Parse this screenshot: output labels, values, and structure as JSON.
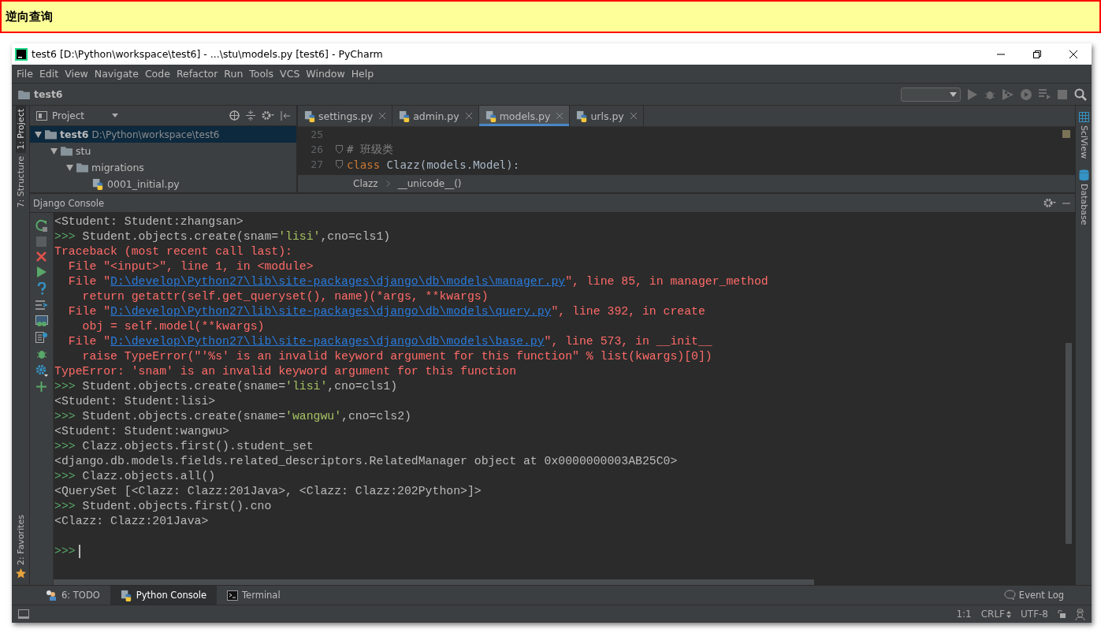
{
  "banner": {
    "title": "逆向查询"
  },
  "window": {
    "title": "test6 [D:\\Python\\workspace\\test6] - ...\\stu\\models.py [test6] - PyCharm"
  },
  "menu": [
    "File",
    "Edit",
    "View",
    "Navigate",
    "Code",
    "Refactor",
    "Run",
    "Tools",
    "VCS",
    "Window",
    "Help"
  ],
  "navigation": {
    "project": "test6"
  },
  "left_strip": [
    {
      "label": "1: Project",
      "selected": true
    },
    {
      "label": "7: Structure",
      "selected": false
    }
  ],
  "favorites": {
    "label": "2: Favorites"
  },
  "project_panel": {
    "title": "Project",
    "tree": [
      {
        "name": "test6",
        "path": "D:\\Python\\workspace\\test6",
        "kind": "folder",
        "selected": true,
        "expanded": true,
        "children": [
          {
            "name": "stu",
            "kind": "folder",
            "selected": false,
            "expanded": true,
            "children": [
              {
                "name": "migrations",
                "kind": "folder",
                "selected": false,
                "expanded": true,
                "children": [
                  {
                    "name": "0001_initial.py",
                    "kind": "python",
                    "selected": false
                  }
                ]
              }
            ]
          }
        ]
      }
    ]
  },
  "editor": {
    "tabs": [
      {
        "label": "settings.py",
        "selected": false
      },
      {
        "label": "admin.py",
        "selected": false
      },
      {
        "label": "models.py",
        "selected": true
      },
      {
        "label": "urls.py",
        "selected": false
      }
    ],
    "lines": [
      {
        "number": "25"
      },
      {
        "number": "26",
        "kind": "comment",
        "text": "# 班级类"
      },
      {
        "number": "27",
        "kind": "code",
        "keyword": "class",
        "text": " Clazz(models.Model):"
      }
    ],
    "breadcrumb": [
      "Clazz",
      "__unicode__()"
    ]
  },
  "right_strip": [
    "SciView",
    "Database"
  ],
  "console": {
    "title": "Django Console",
    "lines": [
      {
        "kind": "output",
        "text": "<Student: Student:zhangsan>"
      },
      {
        "kind": "input",
        "prompt": ">>>",
        "text": "Student.objects.create(snam='lisi',cno=cls1)"
      },
      {
        "kind": "error",
        "text": "Traceback (most recent call last):"
      },
      {
        "kind": "error",
        "text": "  File \"<input>\", line 1, in <module>"
      },
      {
        "kind": "file",
        "prefix": "  File \"",
        "link": "D:\\develop\\Python27\\lib\\site-packages\\django\\db\\models\\manager.py",
        "suffix": "\", line 85, in manager_method"
      },
      {
        "kind": "error",
        "text": "    return getattr(self.get_queryset(), name)(*args, **kwargs)"
      },
      {
        "kind": "file",
        "prefix": "  File \"",
        "link": "D:\\develop\\Python27\\lib\\site-packages\\django\\db\\models\\query.py",
        "suffix": "\", line 392, in create"
      },
      {
        "kind": "error",
        "text": "    obj = self.model(**kwargs)"
      },
      {
        "kind": "file",
        "prefix": "  File \"",
        "link": "D:\\develop\\Python27\\lib\\site-packages\\django\\db\\models\\base.py",
        "suffix": "\", line 573, in __init__"
      },
      {
        "kind": "error",
        "text": "    raise TypeError(\"'%s' is an invalid keyword argument for this function\" % list(kwargs)[0])"
      },
      {
        "kind": "error",
        "text": "TypeError: 'snam' is an invalid keyword argument for this function"
      },
      {
        "kind": "input",
        "prompt": ">>>",
        "text": "Student.objects.create(sname='lisi',cno=cls1)"
      },
      {
        "kind": "output",
        "text": "<Student: Student:lisi>"
      },
      {
        "kind": "input",
        "prompt": ">>>",
        "text": "Student.objects.create(sname='wangwu',cno=cls2)"
      },
      {
        "kind": "output",
        "text": "<Student: Student:wangwu>"
      },
      {
        "kind": "input",
        "prompt": ">>>",
        "text": "Clazz.objects.first().student_set"
      },
      {
        "kind": "output",
        "text": "<django.db.models.fields.related_descriptors.RelatedManager object at 0x0000000003AB25C0>"
      },
      {
        "kind": "input",
        "prompt": ">>>",
        "text": "Clazz.objects.all()"
      },
      {
        "kind": "output",
        "text": "<QuerySet [<Clazz: Clazz:201Java>, <Clazz: Clazz:202Python>]>"
      },
      {
        "kind": "input",
        "prompt": ">>>",
        "text": "Student.objects.first().cno"
      },
      {
        "kind": "output",
        "text": "<Clazz: Clazz:201Java>"
      },
      {
        "kind": "blank"
      },
      {
        "kind": "cursor",
        "prompt": ">>>"
      }
    ]
  },
  "bottom_tabs": [
    {
      "label": "6: TODO",
      "kind": "todo",
      "selected": false
    },
    {
      "label": "Python Console",
      "kind": "python",
      "selected": true
    },
    {
      "label": "Terminal",
      "kind": "terminal",
      "selected": false
    }
  ],
  "event_log": {
    "label": "Event Log"
  },
  "status": {
    "position": "1:1",
    "line_separator": "CRLF",
    "encoding": "UTF-8"
  }
}
